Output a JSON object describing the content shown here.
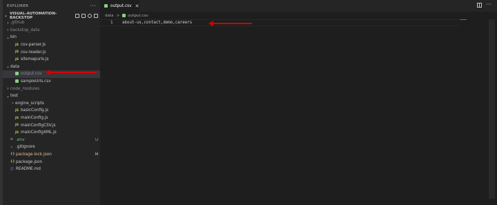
{
  "explorer": {
    "title": "EXPLORER",
    "more": "···",
    "project": "VISUAL-AUTOMATION-BACKSTOP",
    "tree": [
      {
        "label": ".github",
        "kind": "folder",
        "open": false,
        "indent": 0,
        "dim": true
      },
      {
        "label": "backstop_data",
        "kind": "folder",
        "open": false,
        "indent": 0,
        "dim": true
      },
      {
        "label": "bin",
        "kind": "folder",
        "open": true,
        "indent": 0
      },
      {
        "label": "csv-parser.js",
        "kind": "js",
        "icon": "JS",
        "indent": 1
      },
      {
        "label": "csv-reader.js",
        "kind": "js",
        "icon": "JS",
        "indent": 1
      },
      {
        "label": "sitemapurls.js",
        "kind": "js",
        "icon": "JS",
        "indent": 1
      },
      {
        "label": "data",
        "kind": "folder",
        "open": true,
        "indent": 0
      },
      {
        "label": "output.csv",
        "kind": "csv",
        "indent": 1,
        "selected": true,
        "dim": true
      },
      {
        "label": "sampleUrls.csv",
        "kind": "csv",
        "indent": 1
      },
      {
        "label": "node_modules",
        "kind": "folder",
        "open": false,
        "indent": 0,
        "dim": true
      },
      {
        "label": "test",
        "kind": "folder",
        "open": true,
        "indent": 0
      },
      {
        "label": "engine_scripts",
        "kind": "folder",
        "open": false,
        "indent": 1
      },
      {
        "label": "basicConfig.js",
        "kind": "js",
        "icon": "JS",
        "indent": 1
      },
      {
        "label": "mainConfig.js",
        "kind": "js",
        "icon": "JS",
        "indent": 1
      },
      {
        "label": "mainConfigCSV.js",
        "kind": "js",
        "icon": "JS",
        "indent": 1
      },
      {
        "label": "mainConfigXML.js",
        "kind": "js",
        "icon": "JS",
        "indent": 1
      },
      {
        "label": ".env",
        "kind": "env",
        "icon": "⚙",
        "indent": 0,
        "badge": "U",
        "badgeColor": "#73c991",
        "labelColor": "#73c991"
      },
      {
        "label": ".gitignore",
        "kind": "git",
        "icon": "◆",
        "indent": 0
      },
      {
        "label": "package-lock.json",
        "kind": "json",
        "icon": "{}",
        "indent": 0,
        "badge": "M",
        "badgeColor": "#e2c08d",
        "labelColor": "#e2c08d"
      },
      {
        "label": "package.json",
        "kind": "json",
        "icon": "{}",
        "indent": 0
      },
      {
        "label": "README.md",
        "kind": "info",
        "icon": "ⓘ",
        "indent": 0
      }
    ]
  },
  "tab": {
    "label": "output.csv",
    "close": "✕"
  },
  "tab_actions": {
    "more": "···"
  },
  "breadcrumb": {
    "folder": "data",
    "sep": ">",
    "file": "output.csv"
  },
  "editor": {
    "line_number": "1",
    "line_text": "about-us,contact,demo,careers"
  }
}
